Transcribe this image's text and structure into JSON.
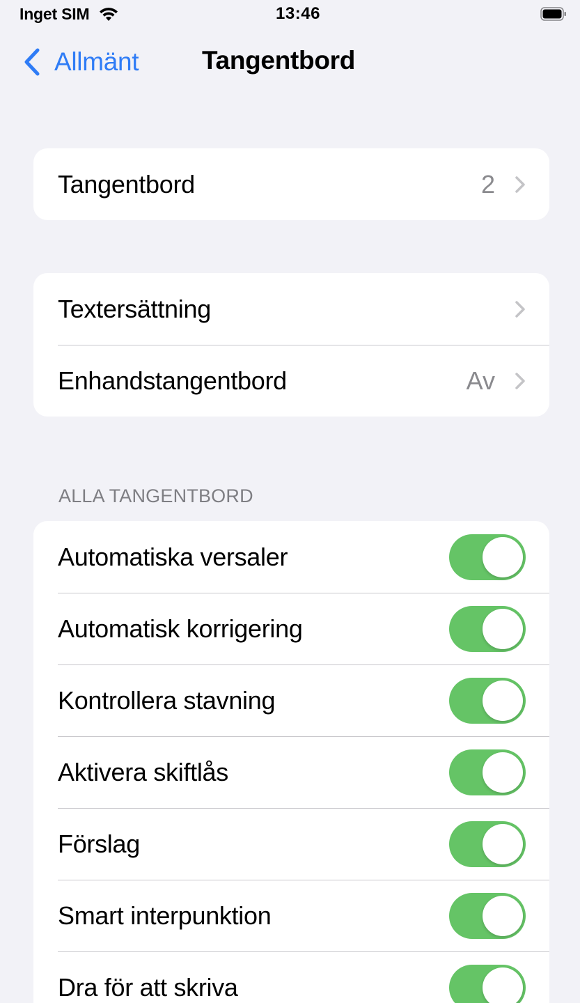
{
  "status_bar": {
    "carrier": "Inget SIM",
    "time": "13:46"
  },
  "nav": {
    "back_label": "Allmänt",
    "title": "Tangentbord"
  },
  "group1": {
    "rows": [
      {
        "label": "Tangentbord",
        "value": "2"
      }
    ]
  },
  "group2": {
    "rows": [
      {
        "label": "Textersättning",
        "value": ""
      },
      {
        "label": "Enhandstangentbord",
        "value": "Av"
      }
    ]
  },
  "all_keyboards": {
    "header": "ALLA TANGENTBORD",
    "toggles": [
      {
        "label": "Automatiska versaler",
        "on": true
      },
      {
        "label": "Automatisk korrigering",
        "on": true
      },
      {
        "label": "Kontrollera stavning",
        "on": true
      },
      {
        "label": "Aktivera skiftlås",
        "on": true
      },
      {
        "label": "Förslag",
        "on": true
      },
      {
        "label": "Smart interpunktion",
        "on": true
      },
      {
        "label": "Dra för att skriva",
        "on": true
      }
    ]
  },
  "colors": {
    "accent": "#2f7cf6",
    "toggle_on": "#65c466",
    "background": "#f2f2f7"
  }
}
